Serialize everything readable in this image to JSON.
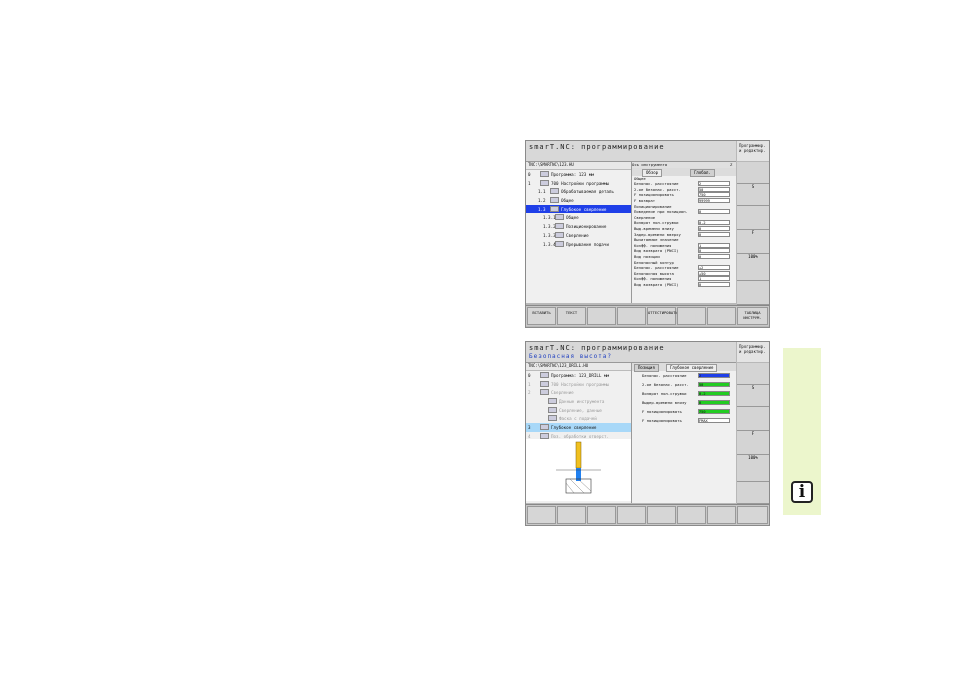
{
  "screen1": {
    "title": "smarT.NC: программирование",
    "mode": "Программир. и редактир.",
    "path": "TNC:\\SMARTNC\\123.HU",
    "tree": [
      {
        "num": "0",
        "label": "Программа: 123 мм"
      },
      {
        "num": "1",
        "label": "700 Настройки программы"
      },
      {
        "num": "1.1",
        "label": "Обрабатываемая деталь"
      },
      {
        "num": "1.2",
        "label": "Общее"
      },
      {
        "num": "1.3",
        "label": "Глубокое сверление"
      },
      {
        "num": "1.3.1",
        "label": "Общее"
      },
      {
        "num": "1.3.2",
        "label": "Позиционирование"
      },
      {
        "num": "1.3.3",
        "label": "Сверление"
      },
      {
        "num": "1.3.4",
        "label": "Прерывание подачи"
      }
    ],
    "form_header": {
      "label": "Ось инструмента",
      "value": "Z"
    },
    "tabs": [
      "Обзор",
      "Глобал."
    ],
    "form": [
      {
        "label": "Общее",
        "value": ""
      },
      {
        "label": "Безопас. расстояние",
        "value": "2"
      },
      {
        "label": "2-ое безопас. расст.",
        "value": "50"
      },
      {
        "label": "F позиционировать",
        "value": "750"
      },
      {
        "label": "F возврат",
        "value": "99999"
      },
      {
        "label": "Позиционирование",
        "value": ""
      },
      {
        "label": "Поведение при позицион.",
        "value": "0"
      },
      {
        "label": "Сверление",
        "value": ""
      },
      {
        "label": "Возврат пол.стружки",
        "value": "0.2"
      },
      {
        "label": "Выд.времени внизу",
        "value": "0"
      },
      {
        "label": "Задер.времени вверху",
        "value": "0"
      },
      {
        "label": "Вычитаемое значение",
        "value": ""
      },
      {
        "label": "Коэфф. понижения",
        "value": "1"
      },
      {
        "label": "Вид возврата (PNCI)",
        "value": "0"
      },
      {
        "label": "Вид позиции",
        "value": "0"
      },
      {
        "label": "Безопасный контур",
        "value": ""
      },
      {
        "label": "Безопас. расстояние",
        "value": "+2"
      },
      {
        "label": "Безопасная высота",
        "value": "+50"
      },
      {
        "label": "Коэфф. понижения",
        "value": "1"
      },
      {
        "label": "Вид возврата (PNCI)",
        "value": "0"
      }
    ],
    "softkeys": [
      "ВСТАВИТЬ",
      "ТЕКСТ",
      "",
      "",
      "ОТТЕСТИРОВАТЬ",
      "",
      "",
      "ТАБЛИЦА ИНСТРУМ."
    ],
    "vkeys": [
      "S",
      "F",
      "",
      "100%",
      "",
      "",
      ""
    ]
  },
  "screen2": {
    "title": "smarT.NC: программирование",
    "subtitle": "Безопасная высота?",
    "mode": "Программир. и редактир.",
    "path": "TNC:\\SMARTNC\\123_DRILL.HU",
    "tree": [
      {
        "num": "0",
        "label": "Программа: 123_DRILL мм"
      },
      {
        "num": "1",
        "label": "700 Настройки программы"
      },
      {
        "num": "2",
        "label": "Сверление"
      },
      {
        "num": "",
        "label": "Данные инструмента"
      },
      {
        "num": "",
        "label": "Сверление, данные"
      },
      {
        "num": "",
        "label": "Фаска с подачей"
      },
      {
        "num": "3",
        "label": "Глубокое сверление"
      },
      {
        "num": "4",
        "label": "Поз. обработки отверст."
      }
    ],
    "tabs": [
      "Позиция",
      "Глубокое сверление"
    ],
    "form": [
      {
        "label": "Безопас. расстояние",
        "value": "2",
        "color": "b"
      },
      {
        "label": "2-ое безопас. расст.",
        "value": "50",
        "color": "g"
      },
      {
        "label": "Возврат пол.стружки",
        "value": "0.2",
        "color": "g"
      },
      {
        "label": "Выдер.времени внизу",
        "value": "0",
        "color": "g"
      },
      {
        "label": "F позиционировать",
        "value": "750",
        "color": "g"
      },
      {
        "label": "F позиционировать",
        "value": "FMAX",
        "color": ""
      }
    ],
    "vkeys": [
      "S",
      "F",
      "",
      "100%",
      "",
      ""
    ]
  },
  "info_icon": "i"
}
